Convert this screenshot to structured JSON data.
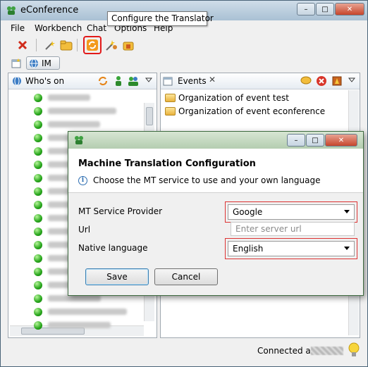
{
  "window": {
    "title": "eConference",
    "controls": {
      "minimize": "–",
      "maximize": "□",
      "close": "✕"
    }
  },
  "tooltip": "Configure the Translator",
  "menubar": [
    "File",
    "Workbench",
    "Chat",
    "Options",
    "Help"
  ],
  "perspective": {
    "im_label": "IM"
  },
  "whos_on": {
    "title": "Who's on",
    "contacts_count": 18
  },
  "events": {
    "title": "Events",
    "items": [
      "Organization of event test",
      "Organization of event econference"
    ]
  },
  "status": {
    "connected_as": "Connected as"
  },
  "dialog": {
    "title": "",
    "heading": "Machine Translation Configuration",
    "info": "Choose the MT service to use and your own language",
    "mt_provider_label": "MT Service Provider",
    "mt_provider_value": "Google",
    "url_label": "Url",
    "url_placeholder": "Enter server url",
    "native_language_label": "Native language",
    "native_language_value": "English",
    "save": "Save",
    "cancel": "Cancel"
  },
  "colors": {
    "highlight": "#e21a1a",
    "online": "#26a51a"
  }
}
